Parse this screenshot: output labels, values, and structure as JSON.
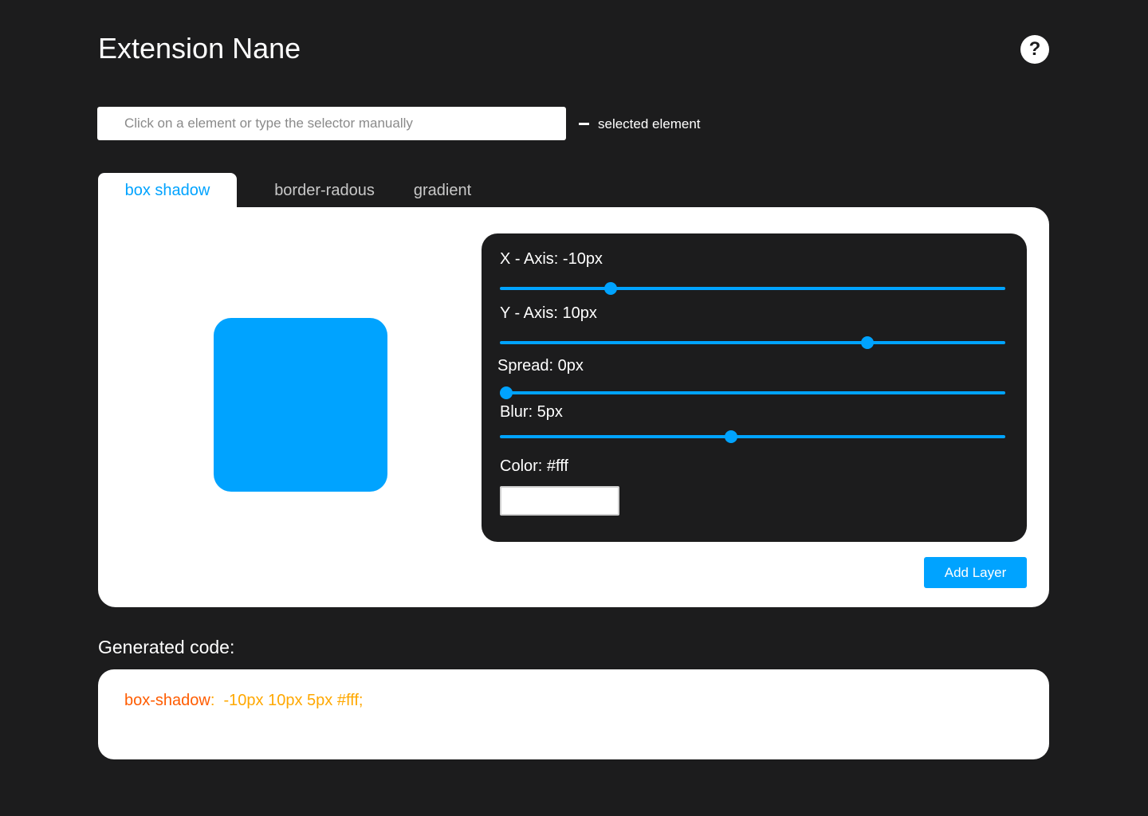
{
  "app": {
    "title": "Extension Nane",
    "help_label": "?"
  },
  "selector": {
    "placeholder": "Click on a element or type the selector manually",
    "value": "",
    "selected_label": "selected element"
  },
  "tabs": [
    {
      "label": "box shadow",
      "active": true
    },
    {
      "label": "border-radous",
      "active": false
    },
    {
      "label": "gradient",
      "active": false
    }
  ],
  "preview": {
    "color": "#00a3ff"
  },
  "controls": {
    "x_axis": {
      "label": "X - Axis: -10px",
      "fraction": 0.22
    },
    "y_axis": {
      "label": "Y - Axis: 10px",
      "fraction": 0.727
    },
    "spread": {
      "label": "Spread: 0px",
      "fraction": 0.012
    },
    "blur": {
      "label": "Blur: 5px",
      "fraction": 0.457
    },
    "color": {
      "label": "Color: #fff",
      "value": "#fff"
    }
  },
  "actions": {
    "add_layer_label": "Add Layer"
  },
  "generated": {
    "title": "Generated code:",
    "property": "box-shadow",
    "colon": ":",
    "value": "  -10px 10px 5px #fff;"
  },
  "colors": {
    "accent": "#00a3ff",
    "background": "#1c1c1d",
    "code_property": "#ff5c00",
    "code_value": "#ffa800"
  }
}
